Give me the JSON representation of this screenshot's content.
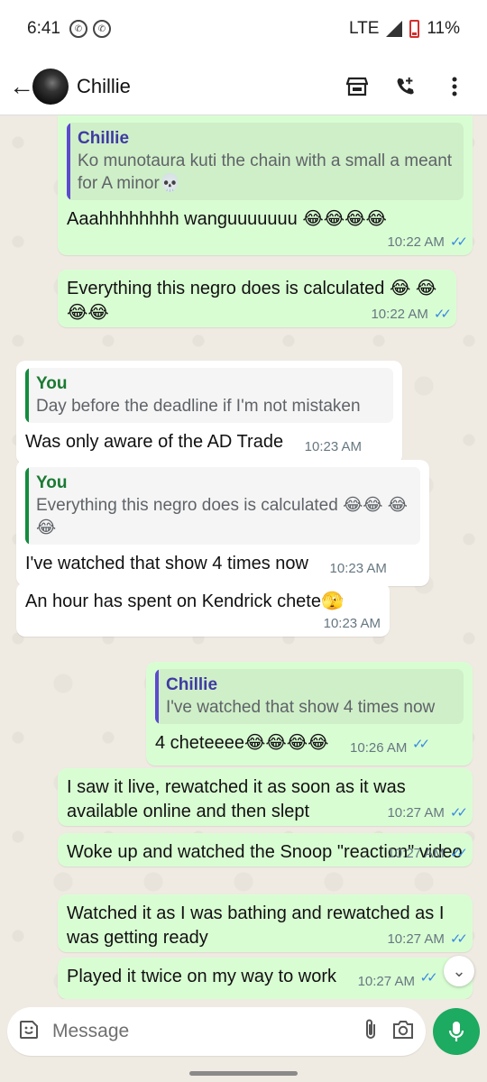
{
  "status": {
    "time": "6:41",
    "network": "LTE",
    "battery": "11%"
  },
  "header": {
    "contact_name": "Chillie",
    "icons": [
      "back-arrow-icon",
      "store-icon",
      "add-call-icon",
      "more-vert-icon"
    ]
  },
  "messages": [
    {
      "direction": "out",
      "quote_name": "Chillie",
      "quote_text": "Ko munotaura kuti the chain with a small a meant for A minor💀",
      "text": "Aaahhhhhhhh wanguuuuuuu 😂😂😂😂",
      "time": "10:22 AM",
      "status": "read"
    },
    {
      "direction": "out",
      "text": "Everything this negro does is calculated 😂 😂😂😂",
      "time": "10:22 AM",
      "status": "read"
    },
    {
      "direction": "in",
      "quote_name": "You",
      "quote_text": "Day before the deadline if I'm not mistaken",
      "text": "Was only aware of the AD Trade",
      "time": "10:23 AM"
    },
    {
      "direction": "in",
      "quote_name": "You",
      "quote_text": "Everything this negro does is calculated 😂😂 😂😂",
      "text": "I've watched that show 4 times now",
      "time": "10:23 AM"
    },
    {
      "direction": "in",
      "text": "An hour has spent on Kendrick chete🫣",
      "time": "10:23 AM"
    },
    {
      "direction": "out",
      "quote_name": "Chillie",
      "quote_text": "I've watched that show 4 times now",
      "text": "4 cheteeee😂😂😂😂",
      "time": "10:26 AM",
      "status": "read"
    },
    {
      "direction": "out",
      "text": "I saw it live, rewatched it as soon as it was available online and then slept",
      "time": "10:27 AM",
      "status": "read"
    },
    {
      "direction": "out",
      "text": "Woke up and watched the Snoop \"reaction\" video",
      "time": "10:27 AM",
      "status": "read"
    },
    {
      "direction": "out",
      "text": "Watched it as I was bathing and rewatched as I was getting ready",
      "time": "10:27 AM",
      "status": "read"
    },
    {
      "direction": "out",
      "text": "Played it twice on my way to work",
      "time": "10:27 AM",
      "status": "read"
    }
  ],
  "composer": {
    "placeholder": "Message"
  },
  "colors": {
    "outgoing_bubble": "#d9fdd3",
    "incoming_bubble": "#ffffff",
    "chat_background": "#efeae2",
    "mic_button": "#1daa61",
    "read_ticks": "#3a8be0"
  }
}
